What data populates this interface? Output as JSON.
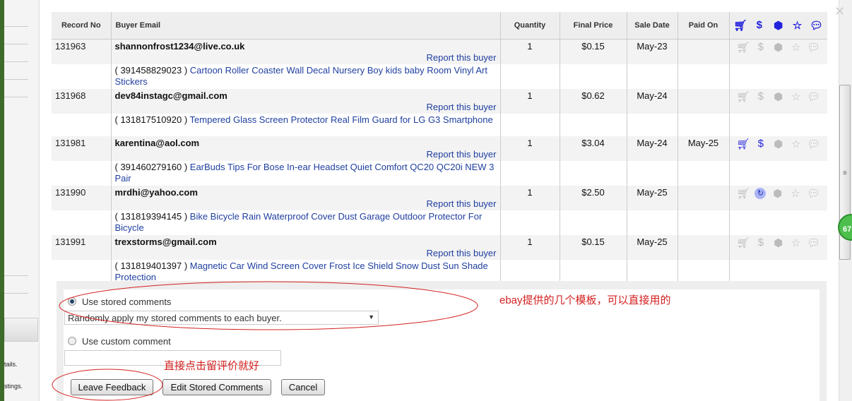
{
  "table": {
    "headers": [
      "Record No",
      "Buyer Email",
      "Quantity",
      "Final Price",
      "Sale Date",
      "Paid On"
    ],
    "icon_headers": [
      "cart-icon",
      "dollar-icon",
      "box-icon",
      "star-icon",
      "comment-icon"
    ],
    "report_label": "Report this buyer",
    "rows": [
      {
        "record": "131963",
        "email": "shannonfrost1234@live.co.uk",
        "item_id": "( 391458829023 )",
        "item_title": "Cartoon Roller Coaster Wall Decal Nursery Boy kids baby Room Vinyl Art Stickers",
        "quantity": "1",
        "price": "$0.15",
        "sale_date": "May-23",
        "paid_on": "",
        "icons": [
          "off",
          "off",
          "off",
          "off",
          "off"
        ]
      },
      {
        "record": "131968",
        "email": "dev84instagc@gmail.com",
        "item_id": "( 131817510920 )",
        "item_title": "Tempered Glass Screen Protector Real Film Guard for LG G3 Smartphone",
        "quantity": "1",
        "price": "$0.62",
        "sale_date": "May-24",
        "paid_on": "",
        "icons": [
          "off",
          "off",
          "off",
          "off",
          "off"
        ]
      },
      {
        "record": "131981",
        "email": "karentina@aol.com",
        "item_id": "( 391460279160 )",
        "item_title": "EarBuds Tips For Bose In-ear Headset Quiet Comfort QC20 QC20i NEW 3 Pair",
        "quantity": "1",
        "price": "$3.04",
        "sale_date": "May-24",
        "paid_on": "May-25",
        "icons": [
          "on",
          "on",
          "off",
          "off",
          "off"
        ]
      },
      {
        "record": "131990",
        "email": "mrdhi@yahoo.com",
        "item_id": "( 131819394145 )",
        "item_title": "Bike Bicycle Rain Waterproof Cover Dust Garage Outdoor Protector For Bicycle",
        "quantity": "1",
        "price": "$2.50",
        "sale_date": "May-25",
        "paid_on": "",
        "icons": [
          "off",
          "special",
          "off",
          "off",
          "off"
        ]
      },
      {
        "record": "131991",
        "email": "trexstorms@gmail.com",
        "item_id": "( 131819401397 )",
        "item_title": "Magnetic Car Wind Screen Cover Frost Ice Shield Snow Dust Sun Shade Protection",
        "quantity": "1",
        "price": "$0.15",
        "sale_date": "May-25",
        "paid_on": "",
        "icons": [
          "off",
          "off",
          "off",
          "off",
          "off"
        ]
      }
    ]
  },
  "comments": {
    "stored_label": "Use stored comments",
    "stored_selected": true,
    "select_value": "Randomly apply my stored comments to each buyer.",
    "custom_label": "Use custom comment",
    "custom_value": ""
  },
  "buttons": {
    "leave": "Leave Feedback",
    "edit": "Edit Stored Comments",
    "cancel": "Cancel"
  },
  "annotations": {
    "note1": "ebay提供的几个模板，可以直接用的",
    "note2": "直接点击留评价就好"
  },
  "background": {
    "badge": "67",
    "text1": "tails.",
    "text2": "stings."
  },
  "colors": {
    "link": "#1f3fa0",
    "active_icon": "#2222dd",
    "annotation": "#d42020"
  }
}
